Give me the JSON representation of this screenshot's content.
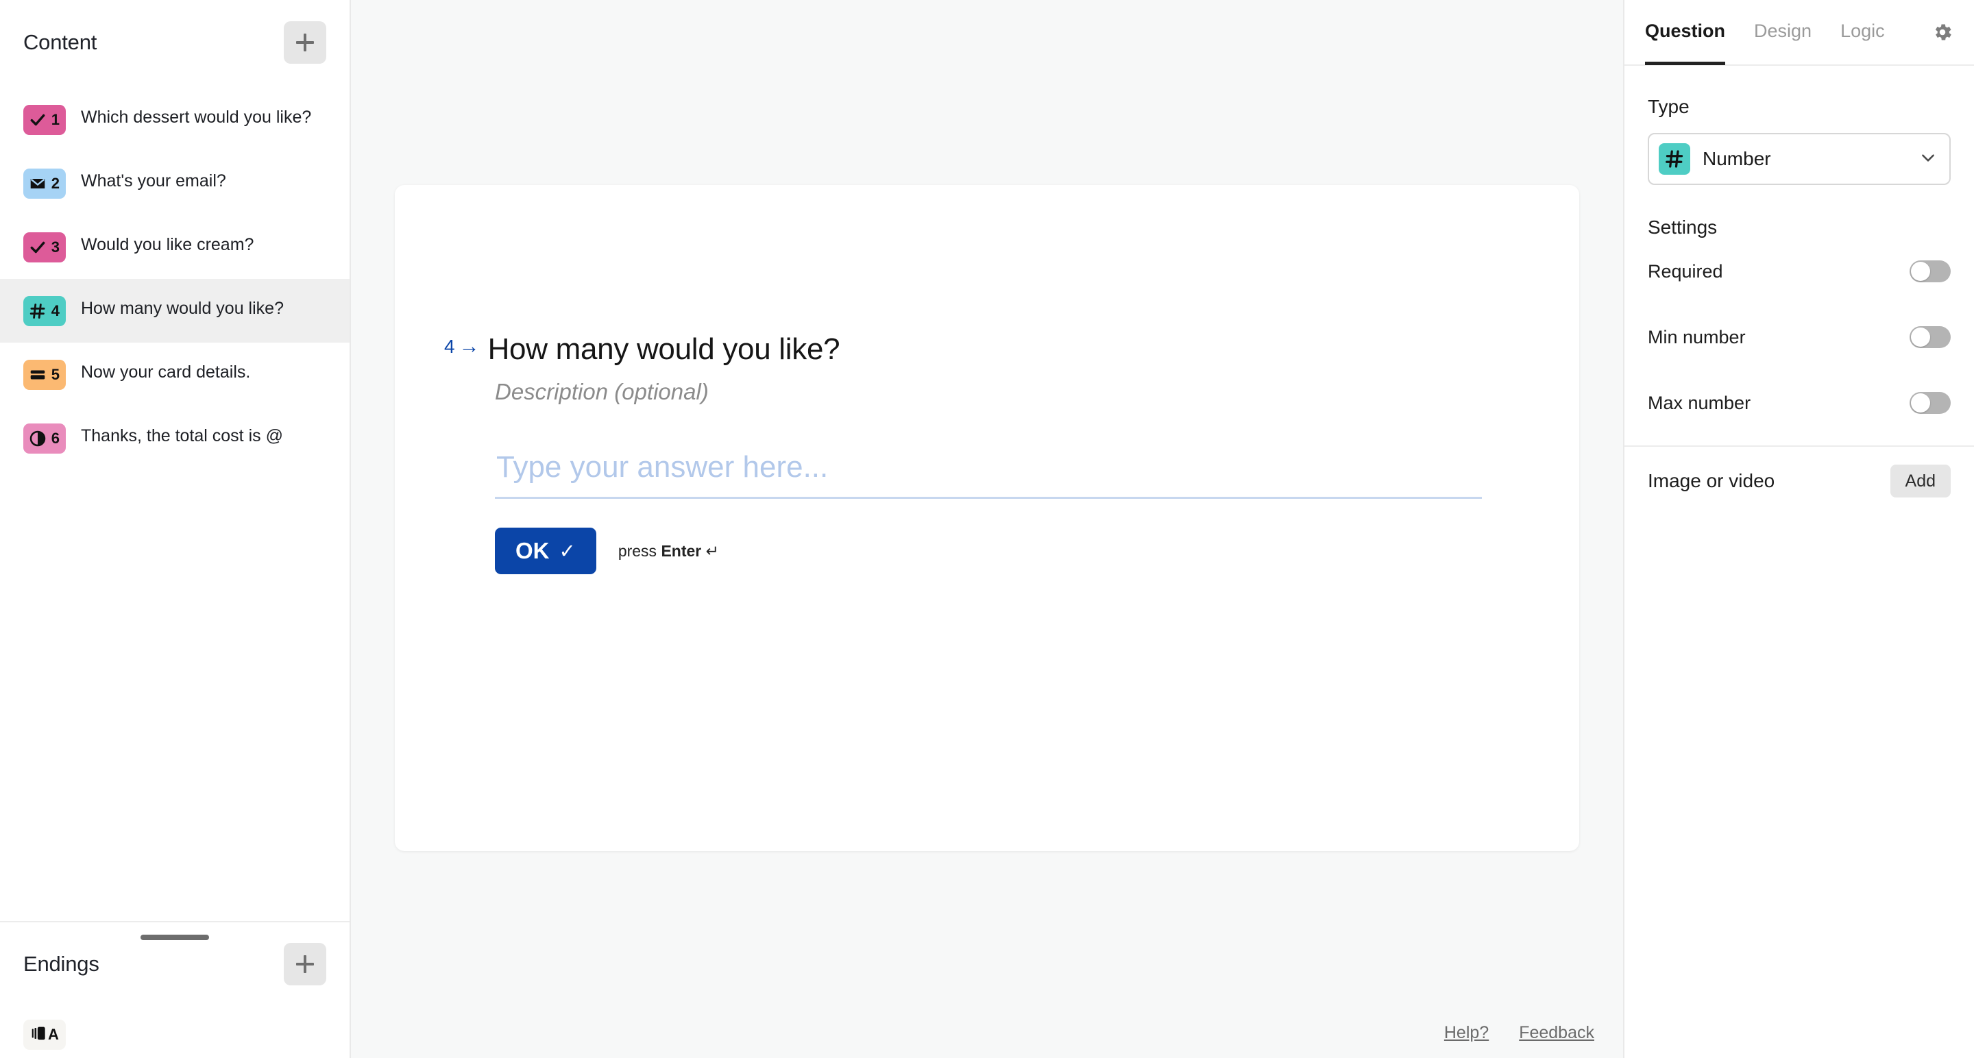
{
  "sidebar": {
    "content": {
      "title": "Content",
      "add_label": "+",
      "items": [
        {
          "num": "1",
          "label": "Which dessert would you like?",
          "icon": "check-icon",
          "color": "#DD5B99",
          "selected": false
        },
        {
          "num": "2",
          "label": "What's your email?",
          "icon": "envelope-icon",
          "color": "#A6D3F5",
          "selected": false
        },
        {
          "num": "3",
          "label": "Would you like cream?",
          "icon": "check-icon",
          "color": "#DD5B99",
          "selected": false
        },
        {
          "num": "4",
          "label": "How many would you like?",
          "icon": "hash-icon",
          "color": "#4ECDC4",
          "selected": true
        },
        {
          "num": "5",
          "label": "Now your card details.",
          "icon": "credit-card-icon",
          "color": "#FBB972",
          "selected": false
        },
        {
          "num": "6",
          "label": "Thanks, the total cost is @",
          "icon": "contrast-circle-icon",
          "color": "#E98CBC",
          "selected": false
        }
      ]
    },
    "endings": {
      "title": "Endings",
      "add_label": "+",
      "items": [
        {
          "letter": "A",
          "icon": "pages-icon",
          "color": "#F6F5F2"
        }
      ]
    }
  },
  "canvas": {
    "question": {
      "index": "4",
      "arrow": "→",
      "headline": "How many would you like?",
      "description_placeholder": "Description (optional)",
      "answer_placeholder": "Type your answer here...",
      "answer_value": "",
      "ok_label": "OK",
      "ok_check": "✓",
      "hint_prefix": "press ",
      "hint_key": "Enter",
      "hint_return": "↵"
    },
    "footer": {
      "help_label": "Help?",
      "feedback_label": "Feedback"
    }
  },
  "right_panel": {
    "tabs": [
      {
        "label": "Question",
        "active": true
      },
      {
        "label": "Design",
        "active": false
      },
      {
        "label": "Logic",
        "active": false
      }
    ],
    "gear_icon": "gear-icon",
    "type": {
      "section_label": "Type",
      "selected": "Number",
      "icon": "hash-icon",
      "icon_color": "#4ECDC4",
      "chevron": "chevron-down-icon"
    },
    "settings": {
      "section_label": "Settings",
      "rows": [
        {
          "label": "Required",
          "value": "off"
        },
        {
          "label": "Min number",
          "value": "off"
        },
        {
          "label": "Max number",
          "value": "off"
        }
      ]
    },
    "media": {
      "label": "Image or video",
      "add_label": "Add"
    }
  },
  "colors": {
    "accent_blue": "#0B45A8",
    "canvas_bg": "#F7F8F8",
    "selected_row": "#EFEFEF",
    "placeholder": "#B2C8EA"
  }
}
